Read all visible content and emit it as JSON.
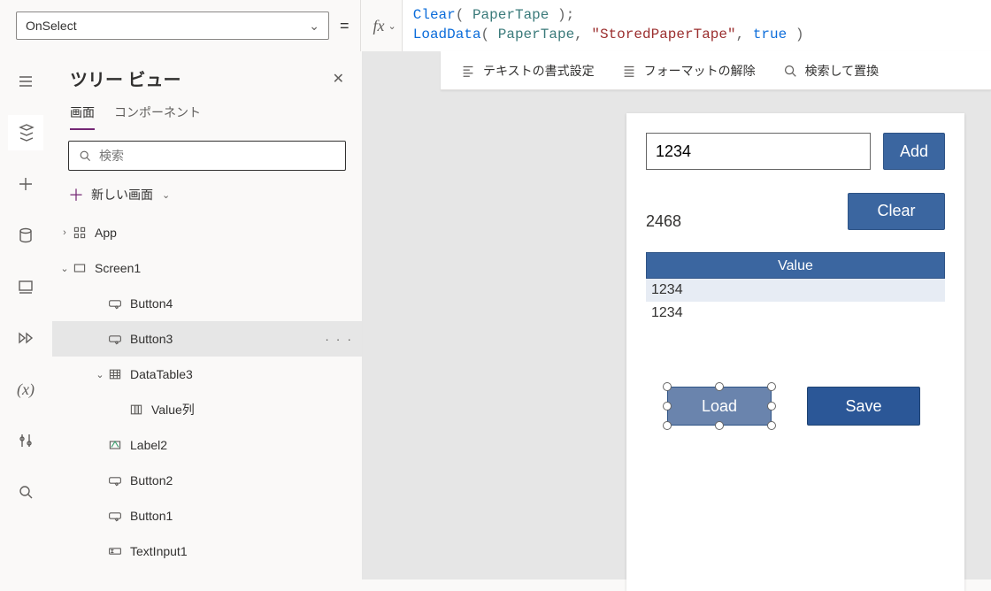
{
  "topbar": {
    "property": "OnSelect",
    "formula_tokens": [
      {
        "t": "Clear",
        "c": "tk-fn"
      },
      {
        "t": "( ",
        "c": "tk-pn"
      },
      {
        "t": "PaperTape",
        "c": "tk-var"
      },
      {
        "t": " );",
        "c": "tk-pn"
      },
      {
        "t": "\n",
        "c": ""
      },
      {
        "t": "LoadData",
        "c": "tk-fn"
      },
      {
        "t": "( ",
        "c": "tk-pn"
      },
      {
        "t": "PaperTape",
        "c": "tk-var"
      },
      {
        "t": ", ",
        "c": "tk-pn"
      },
      {
        "t": "\"StoredPaperTape\"",
        "c": "tk-str"
      },
      {
        "t": ", ",
        "c": "tk-pn"
      },
      {
        "t": "true",
        "c": "tk-kw"
      },
      {
        "t": " )",
        "c": "tk-pn"
      }
    ],
    "tools": {
      "format_text": "テキストの書式設定",
      "remove_format": "フォーマットの解除",
      "find_replace": "検索して置換"
    }
  },
  "tree": {
    "title": "ツリー ビュー",
    "tabs": {
      "screens": "画面",
      "components": "コンポーネント"
    },
    "search_placeholder": "検索",
    "new_screen": "新しい画面",
    "items": [
      {
        "label": "App",
        "icon": "grid",
        "indent": 0,
        "exp": "›"
      },
      {
        "label": "Screen1",
        "icon": "rect",
        "indent": 1,
        "exp": "⌄"
      },
      {
        "label": "Button4",
        "icon": "button",
        "indent": 2
      },
      {
        "label": "Button3",
        "icon": "button",
        "indent": 2,
        "selected": true,
        "more": true
      },
      {
        "label": "DataTable3",
        "icon": "table",
        "indent": 2,
        "exp": "⌄"
      },
      {
        "label": "Value列",
        "icon": "column",
        "indent": 3
      },
      {
        "label": "Label2",
        "icon": "label",
        "indent": 2
      },
      {
        "label": "Button2",
        "icon": "button",
        "indent": 2
      },
      {
        "label": "Button1",
        "icon": "button",
        "indent": 2
      },
      {
        "label": "TextInput1",
        "icon": "textinput",
        "indent": 2
      }
    ]
  },
  "canvas": {
    "input_value": "1234",
    "add_label": "Add",
    "sum_value": "2468",
    "clear_label": "Clear",
    "table_header": "Value",
    "table_rows": [
      "1234",
      "1234"
    ],
    "load_label": "Load",
    "save_label": "Save"
  }
}
